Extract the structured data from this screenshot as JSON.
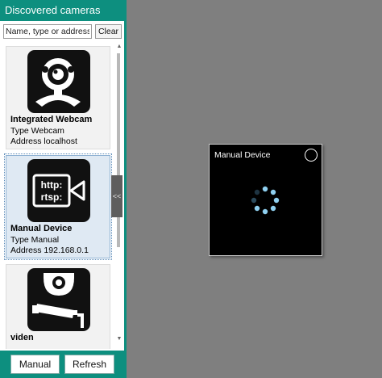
{
  "sidebar": {
    "title": "Discovered cameras",
    "search": {
      "placeholder": "Name, type or address",
      "value": ""
    },
    "clear_label": "Clear",
    "cameras": [
      {
        "name": "Integrated Webcam",
        "type_line": "Type Webcam",
        "address_line": "Address localhost",
        "icon": "webcam-icon"
      },
      {
        "name": "Manual Device",
        "type_line": "Type Manual",
        "address_line": "Address 192.168.0.1",
        "icon": "http-rtsp-camera-icon",
        "icon_text_1": "http:",
        "icon_text_2": "rtsp:",
        "selected": true
      },
      {
        "name": "viden",
        "icon": "security-camera-icon"
      }
    ],
    "collapse_label": "<<",
    "footer": {
      "manual_label": "Manual",
      "refresh_label": "Refresh"
    }
  },
  "device_window": {
    "title": "Manual Device",
    "loading": true
  },
  "colors": {
    "accent": "#0d8f7f",
    "workspace": "#7f7f7f",
    "selected_card": "#dfe9f3",
    "spinner_active": "#8fd0f0",
    "spinner_inactive": "#2b4a5c"
  }
}
